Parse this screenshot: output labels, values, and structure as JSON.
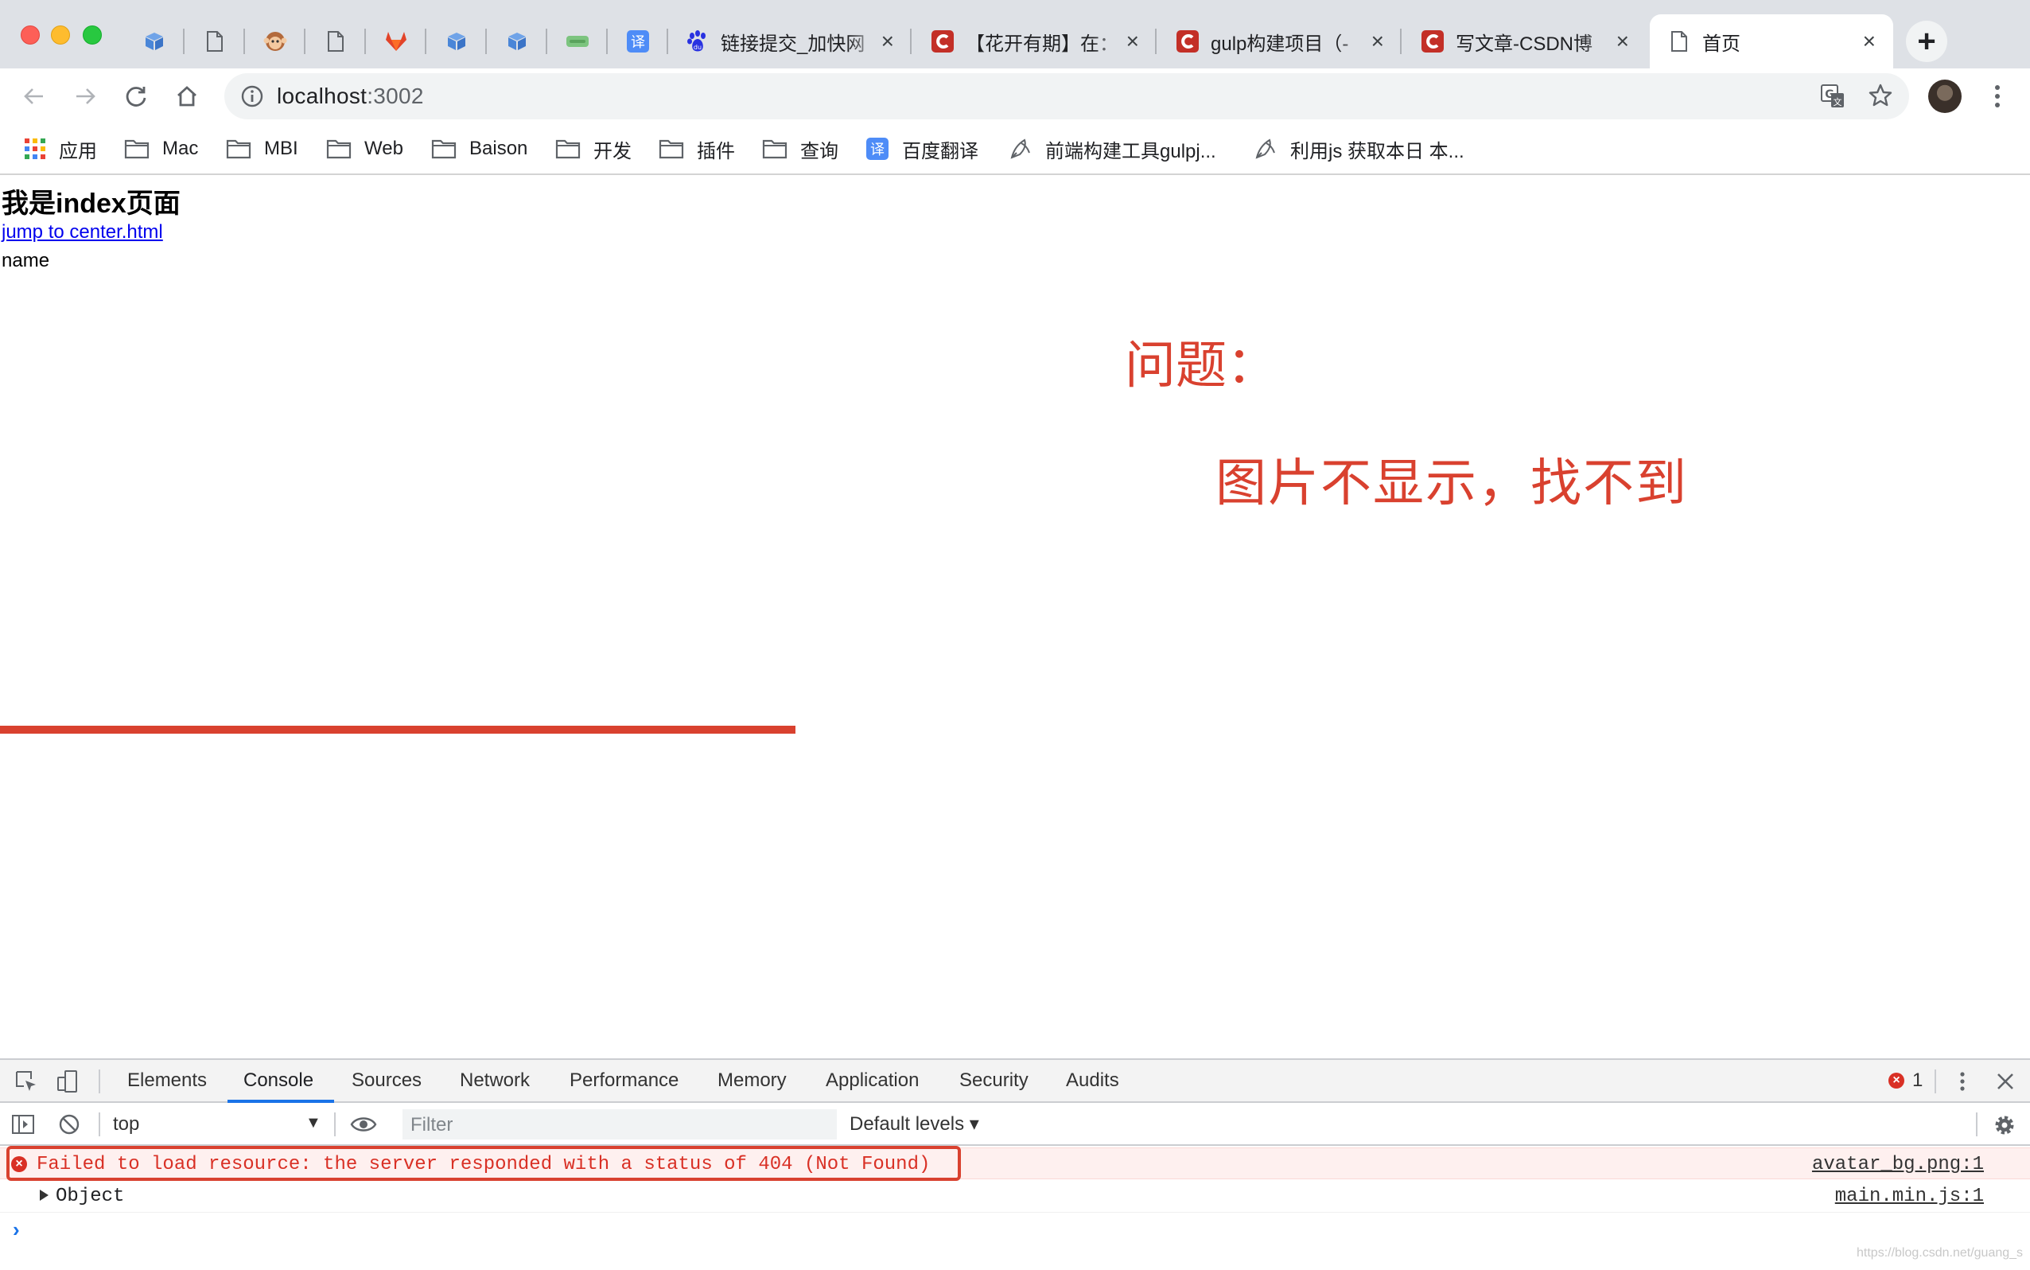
{
  "tabs": [
    {
      "icon": "box-icon",
      "title": ""
    },
    {
      "icon": "page-icon",
      "title": ""
    },
    {
      "icon": "monkey-icon",
      "title": ""
    },
    {
      "icon": "page-icon",
      "title": ""
    },
    {
      "icon": "gitlab-icon",
      "title": ""
    },
    {
      "icon": "box-icon",
      "title": ""
    },
    {
      "icon": "box-icon",
      "title": ""
    },
    {
      "icon": "green-bar-icon",
      "title": ""
    },
    {
      "icon": "translate-icon",
      "title": ""
    },
    {
      "icon": "baidu-icon",
      "title": "链接提交_加快网"
    },
    {
      "icon": "csdn-icon",
      "title": "【花开有期】在："
    },
    {
      "icon": "csdn-icon",
      "title": "gulp构建项目（-"
    },
    {
      "icon": "csdn-icon",
      "title": "写文章-CSDN博"
    },
    {
      "icon": "page-icon",
      "title": "首页",
      "active": true
    }
  ],
  "toolbar": {
    "url_host": "localhost",
    "url_port": ":3002"
  },
  "bookmarks": [
    {
      "icon": "apps-grid-icon",
      "label": "应用"
    },
    {
      "icon": "folder-icon",
      "label": "Mac"
    },
    {
      "icon": "folder-icon",
      "label": "MBI"
    },
    {
      "icon": "folder-icon",
      "label": "Web"
    },
    {
      "icon": "folder-icon",
      "label": "Baison"
    },
    {
      "icon": "folder-icon",
      "label": "开发"
    },
    {
      "icon": "folder-icon",
      "label": "插件"
    },
    {
      "icon": "folder-icon",
      "label": "查询"
    },
    {
      "icon": "translate-icon",
      "label": "百度翻译"
    },
    {
      "icon": "rocket-icon",
      "label": "前端构建工具gulpj..."
    },
    {
      "icon": "rocket-icon",
      "label": "利用js 获取本日 本..."
    }
  ],
  "page": {
    "heading": "我是index页面",
    "link": "jump to center.html",
    "name": "name",
    "note_title": "问题：",
    "note_body": "图片不显示，找不到"
  },
  "devtools": {
    "tabs": [
      "Elements",
      "Console",
      "Sources",
      "Network",
      "Performance",
      "Memory",
      "Application",
      "Security",
      "Audits"
    ],
    "active_tab": "Console",
    "error_count": "1",
    "context": "top",
    "filter_placeholder": "Filter",
    "levels": "Default levels ▾",
    "messages": [
      {
        "type": "error",
        "text": "Failed to load resource: the server responded with a status of 404 (Not Found)",
        "source": "avatar_bg.png:1"
      },
      {
        "type": "log",
        "text": "Object",
        "source": "main.min.js:1"
      }
    ],
    "prompt": "›",
    "watermark": "https://blog.csdn.net/guang_s"
  },
  "colors": {
    "annotation_red": "#d9412f",
    "link_blue": "#0000ee",
    "error_red": "#d93025"
  }
}
